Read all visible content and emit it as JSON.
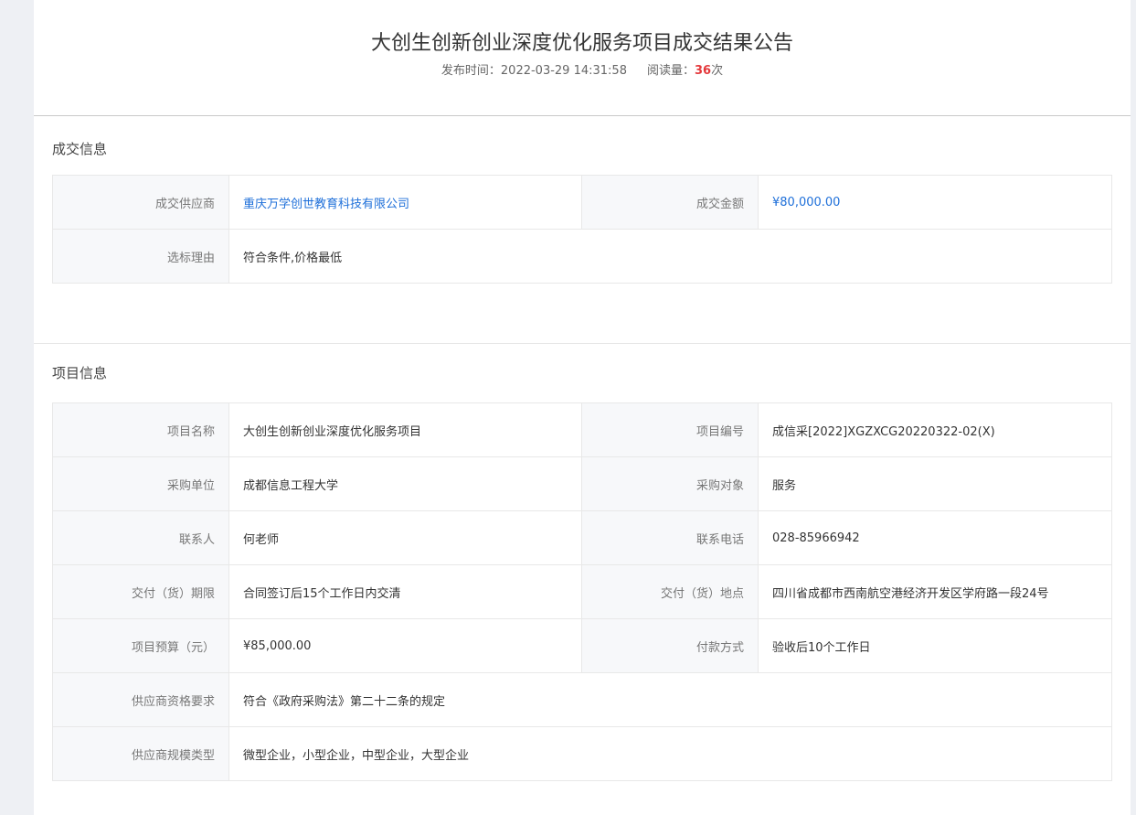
{
  "header": {
    "title": "大创生创新创业深度优化服务项目成交结果公告",
    "publish_label": "发布时间：",
    "publish_time": "2022-03-29 14:31:58",
    "views_label": "阅读量：",
    "views_count": "36",
    "views_unit": "次"
  },
  "deal": {
    "section_title": "成交信息",
    "rows": [
      [
        {
          "label": "成交供应商",
          "value": "重庆万学创世教育科技有限公司"
        },
        {
          "label": "成交金额",
          "value": "¥80,000.00"
        }
      ],
      [
        {
          "label": "选标理由",
          "value": "符合条件,价格最低"
        }
      ]
    ]
  },
  "project": {
    "section_title": "项目信息",
    "rows": [
      [
        {
          "label": "项目名称",
          "value": "大创生创新创业深度优化服务项目"
        },
        {
          "label": "项目编号",
          "value": "成信采[2022]XGZXCG20220322-02(X)"
        }
      ],
      [
        {
          "label": "采购单位",
          "value": "成都信息工程大学"
        },
        {
          "label": "采购对象",
          "value": "服务"
        }
      ],
      [
        {
          "label": "联系人",
          "value": "何老师"
        },
        {
          "label": "联系电话",
          "value": "028-85966942"
        }
      ],
      [
        {
          "label": "交付（货）期限",
          "value": "合同签订后15个工作日内交清"
        },
        {
          "label": "交付（货）地点",
          "value": "四川省成都市西南航空港经济开发区学府路一段24号"
        }
      ],
      [
        {
          "label": "项目预算（元）",
          "value": "¥85,000.00"
        },
        {
          "label": "付款方式",
          "value": "验收后10个工作日"
        }
      ],
      [
        {
          "label": "供应商资格要求",
          "value": "符合《政府采购法》第二十二条的规定"
        }
      ],
      [
        {
          "label": "供应商规模类型",
          "value": "微型企业，小型企业，中型企业，大型企业"
        }
      ]
    ]
  }
}
